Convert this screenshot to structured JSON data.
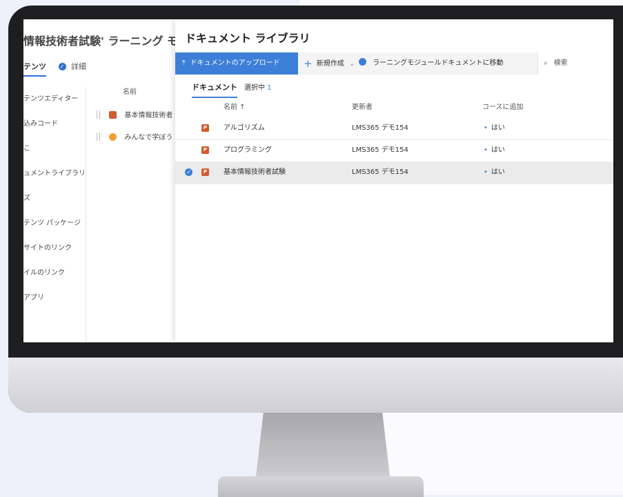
{
  "background_page": {
    "title": "情報技術者試験' ラーニング モジュ",
    "tab_content": "テンツ",
    "tab_details": "詳細",
    "sidebar": [
      "テンツエディター",
      "込みコード",
      "こ",
      "ュメントライブラリ",
      "ズ",
      "テンツ パッケージ",
      "サイトのリンク",
      "イルのリンク",
      "アプリ"
    ],
    "col_name": "名前",
    "rows": [
      {
        "icon": "powerpoint-icon",
        "name": "基本情報技術者"
      },
      {
        "icon": "video-icon",
        "name": "みんなで学ぼう"
      }
    ]
  },
  "panel": {
    "title": "ドキュメント ライブラリ",
    "toolbar": {
      "upload": "ドキュメントのアップロード",
      "new": "新規作成",
      "move": "ラーニングモジュールドキュメントに移動",
      "search_placeholder": "検索"
    },
    "tabs": {
      "documents": "ドキュメント",
      "selected_label": "選択中",
      "selected_count": "1"
    },
    "columns": {
      "name": "名前 ↑",
      "modified_by": "更新者",
      "add_to_course": "コースに追加"
    },
    "rows": [
      {
        "name": "アルゴリズム",
        "modified_by": "LMS365 デモ154",
        "add": "はい",
        "selected": false
      },
      {
        "name": "プログラミング",
        "modified_by": "LMS365 デモ154",
        "add": "はい",
        "selected": false
      },
      {
        "name": "基本情報技術者試験",
        "modified_by": "LMS365 デモ154",
        "add": "はい",
        "selected": true
      }
    ]
  },
  "colors": {
    "accent": "#3d7fd8",
    "powerpoint": "#d25b2f",
    "video": "#f0a030"
  }
}
